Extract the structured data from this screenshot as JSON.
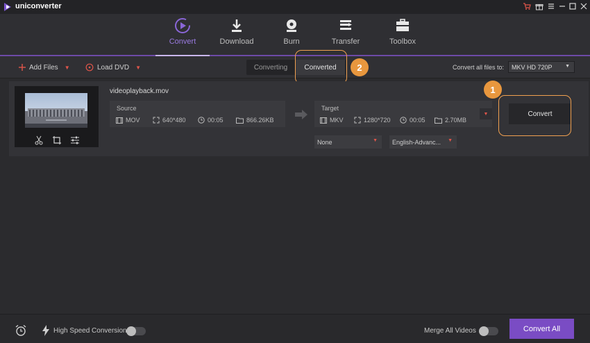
{
  "window": {
    "title": "uniconverter",
    "buttons": [
      "cart-icon",
      "gift-icon",
      "menu-icon",
      "minimize-icon",
      "maximize-icon",
      "close-icon"
    ]
  },
  "nav": {
    "tabs": [
      {
        "label": "Convert",
        "icon": "play-circle-icon",
        "active": true
      },
      {
        "label": "Download",
        "icon": "download-icon",
        "active": false
      },
      {
        "label": "Burn",
        "icon": "disc-icon",
        "active": false
      },
      {
        "label": "Transfer",
        "icon": "transfer-icon",
        "active": false
      },
      {
        "label": "Toolbox",
        "icon": "toolbox-icon",
        "active": false
      }
    ]
  },
  "toolbar": {
    "add_files": "Add Files",
    "load_dvd": "Load DVD",
    "segment_converting": "Converting",
    "segment_converted": "Converted",
    "convert_all_to_label": "Convert all files to:",
    "format_value": "MKV HD 720P"
  },
  "file": {
    "name": "videoplayback.mov",
    "source": {
      "title": "Source",
      "format": "MOV",
      "resolution": "640*480",
      "duration": "00:05",
      "size": "866.26KB"
    },
    "target": {
      "title": "Target",
      "format": "MKV",
      "resolution": "1280*720",
      "duration": "00:05",
      "size": "2.70MB"
    },
    "subtitle": "None",
    "audio": "English-Advanc...",
    "convert_label": "Convert"
  },
  "callouts": {
    "one": "1",
    "two": "2"
  },
  "bottom": {
    "high_speed_label": "High Speed Conversion",
    "merge_label": "Merge All Videos",
    "convert_all_label": "Convert All",
    "high_speed_on": false,
    "merge_on": false
  },
  "colors": {
    "accent": "#7a4cc4",
    "active_tab": "#9a7ae0",
    "callout": "#e8973e",
    "caret": "#e0554a"
  }
}
